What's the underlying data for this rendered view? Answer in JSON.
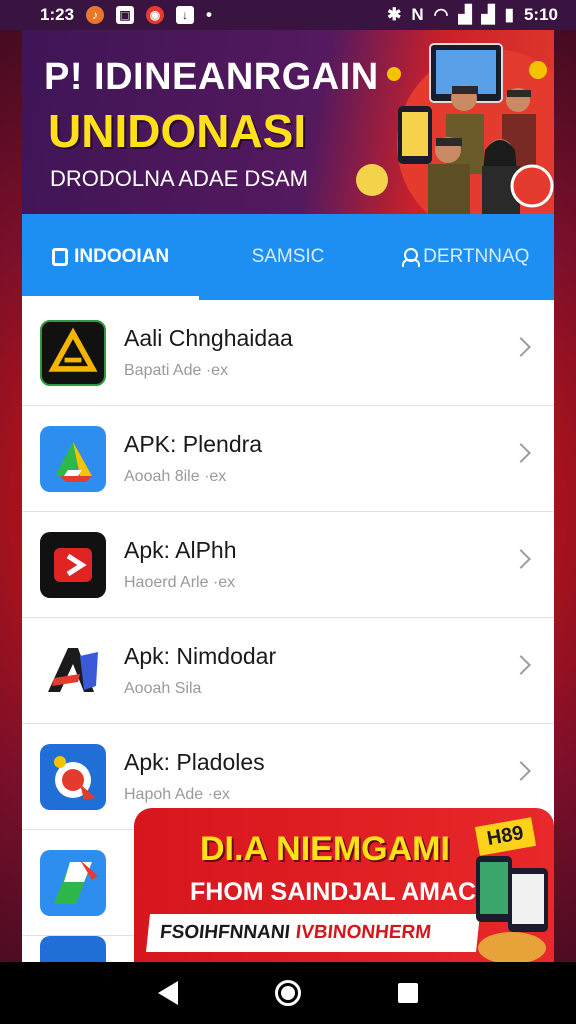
{
  "status_bar": {
    "time": "1:23",
    "right_time": "5:10",
    "icons": [
      "music-notification-icon",
      "photo-notification-icon",
      "record-notification-icon",
      "download-notification-icon",
      "dot-icon",
      "bluetooth-icon",
      "nfc-icon",
      "wifi-icon",
      "signal-icon",
      "signal-icon",
      "battery-icon"
    ]
  },
  "banner": {
    "line1": "P! IDINEANRGAIN",
    "line2": "UNIDONASI",
    "line3": "DRODOLNA ADAE DSAM"
  },
  "tabs": [
    {
      "label": "INDOOIAN",
      "icon": "bookmark-icon",
      "active": true
    },
    {
      "label": "SAMSIC",
      "icon": "",
      "active": false
    },
    {
      "label": "DERTNNAQ",
      "icon": "user-icon",
      "active": false
    }
  ],
  "apps": [
    {
      "title": "Aali Chnghaidaa",
      "subtitle": "Bapati Ade ·ex",
      "icon": "warning-triangle-icon"
    },
    {
      "title": "APK: Plendra",
      "subtitle": "Aooah 8ile ·ex",
      "icon": "drive-triangle-icon"
    },
    {
      "title": "Apk: AlPhh",
      "subtitle": "Haoerd Arle ·ex",
      "icon": "play-arrow-icon"
    },
    {
      "title": "Apk: Nimdodar",
      "subtitle": "Aooah Sila",
      "icon": "letter-a-icon"
    },
    {
      "title": "Apk: Pladoles",
      "subtitle": "Hapoh Ade ·ex",
      "icon": "target-icon"
    }
  ],
  "promo": {
    "line1": "DI.A NIEMGAMI",
    "line2": "FHOM SAINDJAL AMACA!!",
    "line3_a": "FSOIHFNNANI",
    "line3_b": "IVBINONHERM",
    "badge": "H89"
  },
  "colors": {
    "accent": "#1e8ff2",
    "banner_dark": "#3e1556",
    "banner_yellow": "#ffe11a",
    "promo_red": "#d7151d"
  }
}
